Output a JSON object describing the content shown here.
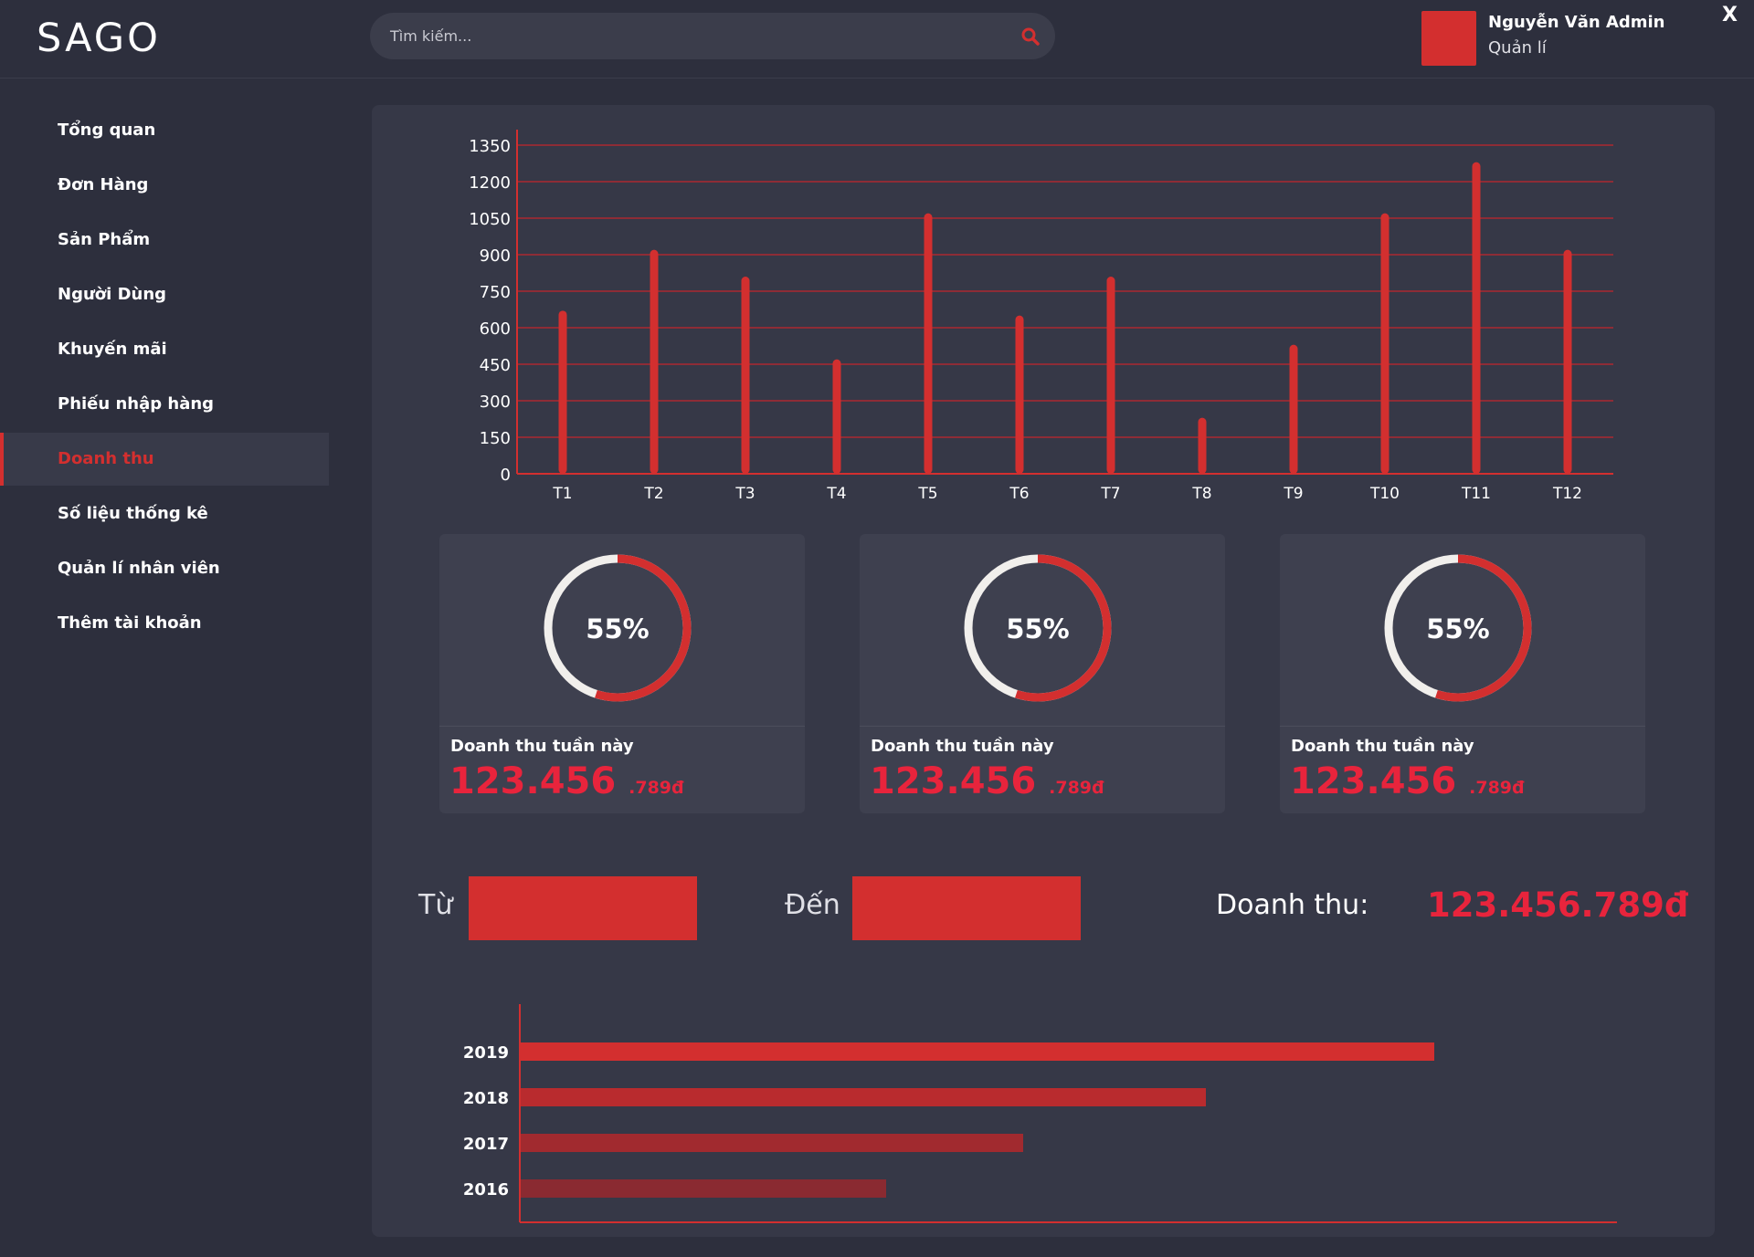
{
  "header": {
    "logo": "SAGO",
    "search_placeholder": "Tìm kiếm...",
    "user_name": "Nguyễn Văn Admin",
    "user_role": "Quản lí",
    "close_label": "X"
  },
  "sidebar": {
    "items": [
      {
        "label": "Tổng quan",
        "active": false
      },
      {
        "label": "Đơn Hàng",
        "active": false
      },
      {
        "label": "Sản Phẩm",
        "active": false
      },
      {
        "label": "Người Dùng",
        "active": false
      },
      {
        "label": "Khuyến mãi",
        "active": false
      },
      {
        "label": "Phiếu nhập hàng",
        "active": false
      },
      {
        "label": "Doanh thu",
        "active": true
      },
      {
        "label": "Số liệu thống kê",
        "active": false
      },
      {
        "label": "Quản lí nhân viên",
        "active": false
      },
      {
        "label": "Thêm tài khoản",
        "active": false
      }
    ]
  },
  "cards": [
    {
      "percent": 55,
      "percent_label": "55%",
      "label": "Doanh thu tuần này",
      "value_main": "123.456",
      "value_small": ".789đ"
    },
    {
      "percent": 55,
      "percent_label": "55%",
      "label": "Doanh thu tuần này",
      "value_main": "123.456",
      "value_small": ".789đ"
    },
    {
      "percent": 55,
      "percent_label": "55%",
      "label": "Doanh thu tuần này",
      "value_main": "123.456",
      "value_small": ".789đ"
    }
  ],
  "filter": {
    "from_label": "Từ",
    "to_label": "Đến",
    "revenue_label": "Doanh thu:",
    "revenue_value": "123.456.789đ"
  },
  "colors": {
    "accent": "#d32f2f",
    "value_red": "#e8243c",
    "background": "#2d2f3d",
    "panel": "#363847"
  },
  "chart_data": [
    {
      "type": "bar",
      "categories": [
        "T1",
        "T2",
        "T3",
        "T4",
        "T5",
        "T6",
        "T7",
        "T8",
        "T9",
        "T10",
        "T11",
        "T12"
      ],
      "values": [
        670,
        920,
        810,
        470,
        1070,
        650,
        810,
        230,
        530,
        1070,
        1280,
        920
      ],
      "yticks": [
        "0",
        "150",
        "300",
        "450",
        "600",
        "750",
        "900",
        "1050",
        "1200",
        "1350"
      ],
      "ylim": [
        0,
        1350
      ],
      "grid": true
    },
    {
      "type": "bar",
      "orientation": "horizontal",
      "categories": [
        "2019",
        "2018",
        "2017",
        "2016"
      ],
      "values": [
        100,
        75,
        55,
        40
      ],
      "colors": [
        "#d32f2f",
        "#b92b2e",
        "#a12a2f",
        "#8a2a31"
      ]
    }
  ]
}
